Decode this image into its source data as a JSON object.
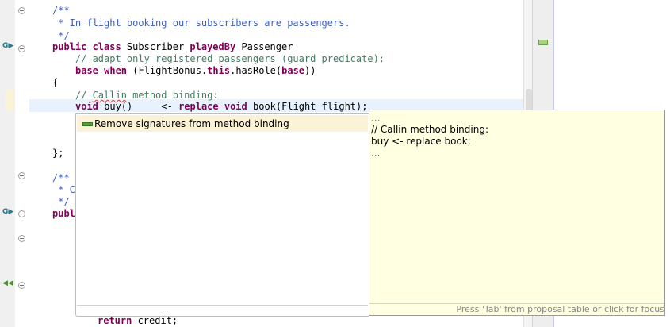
{
  "code": {
    "l1": "/**",
    "l2": " * In flight booking our subscribers are passengers.",
    "l3": " */",
    "l4_kw1": "public class",
    "l4_t1": " Subscriber ",
    "l4_kw2": "playedBy",
    "l4_t2": " Passenger",
    "l5": "    // adapt only registered passengers (guard predicate):",
    "l6_kw1": "base when",
    "l6_t1": " (FlightBonus.",
    "l6_kw2": "this",
    "l6_t2": ".hasRole(",
    "l6_kw3": "base",
    "l6_t3": "))",
    "l7": "{",
    "l8_pre": "    // ",
    "l8_squig": "Callin",
    "l8_post": " method binding:",
    "l9_kw1": "void",
    "l9_t1": " buy()     <- ",
    "l9_kw2": "replace void",
    "l9_t2": " book(Flight flight);",
    "l12": "};",
    "l14": "/**",
    "l15": " * C",
    "l16": " */",
    "l17": "publ",
    "l_last_kw": "return",
    "l_last_t": " credit;"
  },
  "proposal": {
    "item": "Remove signatures from method binding"
  },
  "info": {
    "line1": "...",
    "line2": "// Callin method binding:",
    "line3": "buy <- replace book;",
    "line4": "...",
    "hint": "Press 'Tab' from proposal table or click for focus"
  }
}
